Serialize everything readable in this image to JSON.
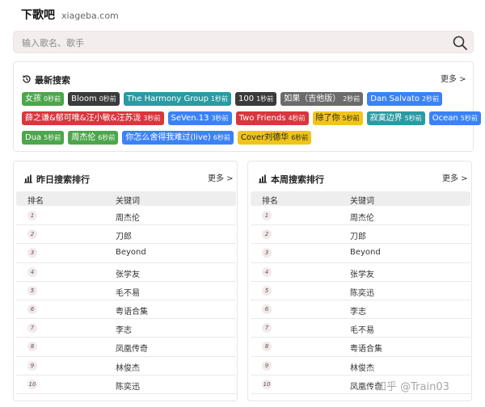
{
  "header": {
    "brand": "下歌吧",
    "domain": "xiageba.com"
  },
  "search": {
    "placeholder": "输入歌名、歌手"
  },
  "latest": {
    "title": "最新搜索",
    "more": "更多 >",
    "rows": [
      [
        {
          "name": "女孩",
          "time": "0秒前",
          "color": "#4ca64c"
        },
        {
          "name": "Bloom",
          "time": "0秒前",
          "color": "#3b3b3b"
        },
        {
          "name": "The Harmony Group",
          "time": "1秒前",
          "color": "#2a9aa3"
        },
        {
          "name": "100",
          "time": "1秒前",
          "color": "#3b3b3b"
        },
        {
          "name": "如果（吉他版）",
          "time": "2秒前",
          "color": "#6b6b6b"
        },
        {
          "name": "Dan Salvato",
          "time": "2秒前",
          "color": "#3b82f6"
        }
      ],
      [
        {
          "name": "薛之谦&郁可唯&汪小敏&汪苏泷",
          "time": "3秒前",
          "color": "#d9363e"
        },
        {
          "name": "SeVen.13",
          "time": "3秒前",
          "color": "#3b82f6"
        },
        {
          "name": "Two Friends",
          "time": "4秒前",
          "color": "#d9363e"
        },
        {
          "name": "除了你",
          "time": "5秒前",
          "color": "#f0c419",
          "dark": true
        },
        {
          "name": "寂寞边界",
          "time": "5秒前",
          "color": "#2a9aa3"
        },
        {
          "name": "Ocean",
          "time": "5秒前",
          "color": "#3b82f6"
        }
      ],
      [
        {
          "name": "Dua",
          "time": "5秒前",
          "color": "#4ca64c"
        },
        {
          "name": "周杰伦",
          "time": "6秒前",
          "color": "#4ca64c"
        },
        {
          "name": "你怎么舍得我难过(live)",
          "time": "6秒前",
          "color": "#3b82f6"
        },
        {
          "name": "Cover刘德华",
          "time": "6秒前",
          "color": "#f0c419",
          "dark": true
        }
      ]
    ]
  },
  "yesterday": {
    "title": "昨日搜索排行",
    "more": "更多 >",
    "col_rank": "排名",
    "col_keyword": "关键词",
    "items": [
      "周杰伦",
      "刀郎",
      "Beyond",
      "张学友",
      "毛不易",
      "粤语合集",
      "李志",
      "凤凰传奇",
      "林俊杰",
      "陈奕迅"
    ]
  },
  "week": {
    "title": "本周搜索排行",
    "more": "更多 >",
    "col_rank": "排名",
    "col_keyword": "关键词",
    "items": [
      "周杰伦",
      "刀郎",
      "Beyond",
      "张学友",
      "陈奕迅",
      "李志",
      "毛不易",
      "粤语合集",
      "林俊杰",
      "凤凰传奇"
    ]
  },
  "watermark": "知乎 @Train03"
}
